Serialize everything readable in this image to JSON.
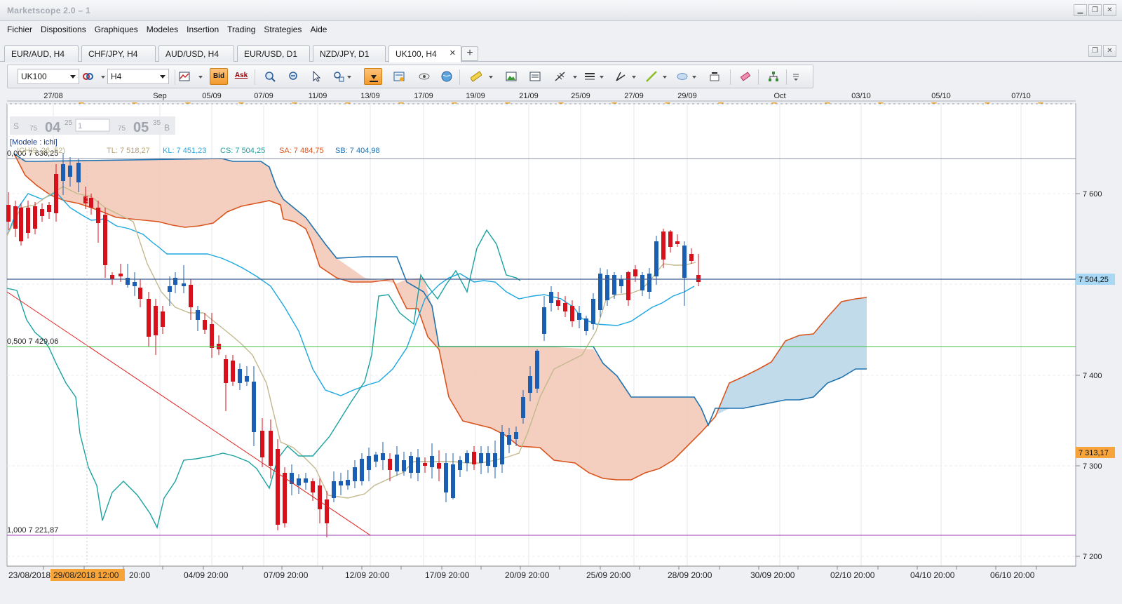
{
  "window": {
    "title": "Marketscope 2.0 – 1"
  },
  "menu": [
    "Fichier",
    "Dispositions",
    "Graphiques",
    "Modeles",
    "Insertion",
    "Trading",
    "Strategies",
    "Aide"
  ],
  "tabs": [
    {
      "label": "EUR/AUD, H4",
      "active": false
    },
    {
      "label": "CHF/JPY, H4",
      "active": false
    },
    {
      "label": "AUD/USD, H4",
      "active": false
    },
    {
      "label": "EUR/USD, D1",
      "active": false
    },
    {
      "label": "NZD/JPY, D1",
      "active": false
    },
    {
      "label": "UK100, H4",
      "active": true
    }
  ],
  "toolbar": {
    "symbol": "UK100",
    "timeframe": "H4",
    "bid_label": "Bid",
    "ask_label": "Ask",
    "icons": [
      "chart-type-icon",
      "bid-icon",
      "ask-icon",
      "zoom-in-icon",
      "zoom-out-icon",
      "cursor-icon",
      "magnifier-icon",
      "autoscroll-icon",
      "properties-icon",
      "eye-icon",
      "globe-icon",
      "ruler-icon",
      "image-icon",
      "indicator-icon",
      "fibonacci-icon",
      "lines-icon",
      "pencil-icon",
      "trendline-icon",
      "ellipse-icon",
      "text-icon",
      "eraser-icon",
      "hierarchy-icon"
    ]
  },
  "chart": {
    "top_dates": [
      "27/08",
      "Sep",
      "05/09",
      "07/09",
      "11/09",
      "13/09",
      "17/09",
      "19/09",
      "21/09",
      "25/09",
      "27/09",
      "29/09",
      "Oct",
      "03/10",
      "05/10",
      "07/10"
    ],
    "bottom_dates": [
      "23/08/2018",
      "29/08/2018 12:00",
      "20:00",
      "04/09 20:00",
      "07/09 20:00",
      "12/09 20:00",
      "17/09 20:00",
      "20/09 20:00",
      "25/09 20:00",
      "28/09 20:00",
      "30/09 20:00",
      "02/10 20:00",
      "04/10 20:00",
      "06/10 20:00"
    ],
    "y_ticks": [
      "7 600",
      "7 400",
      "7 300",
      "7 200"
    ],
    "price_tags": [
      {
        "label": "7 504,25",
        "color": "#a9d8f5"
      },
      {
        "label": "7 313,17",
        "color": "#f7a53a"
      }
    ],
    "quote": {
      "s_label": "S",
      "sell_small": "75",
      "sell_big": "04",
      "sell_sup": "25",
      "amount": "1",
      "buy_small": "75",
      "buy_big": "05",
      "buy_sup": "35",
      "b_label": "B"
    },
    "model_label": "[Modele : ichi]",
    "indicator_values": [
      {
        "text": "ICH(9, 26, 52)",
        "color": "#b8b080"
      },
      {
        "text": "TL: 7 518,27",
        "color": "#b8a070"
      },
      {
        "text": "KL: 7 451,23",
        "color": "#2ba7d9"
      },
      {
        "text": "CS: 7 504,25",
        "color": "#1a9fa0"
      },
      {
        "text": "SA: 7 484,75",
        "color": "#d9541e"
      },
      {
        "text": "SB: 7 404,98",
        "color": "#1e72b0"
      }
    ],
    "fib_levels": [
      {
        "label": "0,000 7 636,25",
        "color": "#8b8fa4"
      },
      {
        "label": "0,500 7 429,06",
        "color": "#3cc13c"
      },
      {
        "label": "1,000 7 221,87",
        "color": "#a040b0"
      }
    ],
    "colors": {
      "bull": "#1a5fb4",
      "bear": "#d8101b",
      "kumo_bear": "#f2c7b4",
      "kumo_bull": "#bcdcee",
      "hline": "#3b5b8c"
    }
  }
}
